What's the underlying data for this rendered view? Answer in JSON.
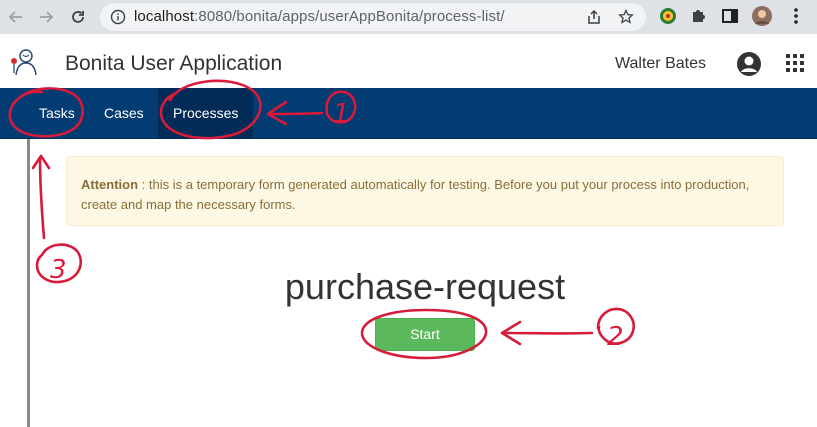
{
  "browser": {
    "url_host": "localhost",
    "url_rest": ":8080/bonita/apps/userAppBonita/process-list/",
    "back_icon": "arrow-left-icon",
    "forward_icon": "arrow-right-icon",
    "reload_icon": "reload-icon",
    "info_icon": "info-icon",
    "share_icon": "share-icon",
    "bookmark_icon": "star-icon",
    "extension_icon": "puzzle-icon",
    "sidepanel_icon": "side-panel-icon",
    "menu_icon": "kebab-menu-icon"
  },
  "header": {
    "app_title": "Bonita User Application",
    "user_name": "Walter Bates",
    "avatar_icon": "user-circle-icon",
    "apps_icon": "grid-icon"
  },
  "nav": {
    "items": [
      {
        "label": "Tasks"
      },
      {
        "label": "Cases"
      },
      {
        "label": "Processes"
      }
    ],
    "active": "Processes"
  },
  "alert": {
    "strong": "Attention",
    "text": " : this is a temporary form generated automatically for testing. Before you put your process into production, create and map the necessary forms."
  },
  "process": {
    "name": "purchase-request",
    "start_label": "Start"
  },
  "annotations": {
    "labels": [
      "1",
      "2",
      "3"
    ],
    "color": "#d81b3a"
  },
  "colors": {
    "navbar": "#033b73",
    "start_button": "#5cb85c",
    "alert_bg": "#fcf8e3"
  }
}
